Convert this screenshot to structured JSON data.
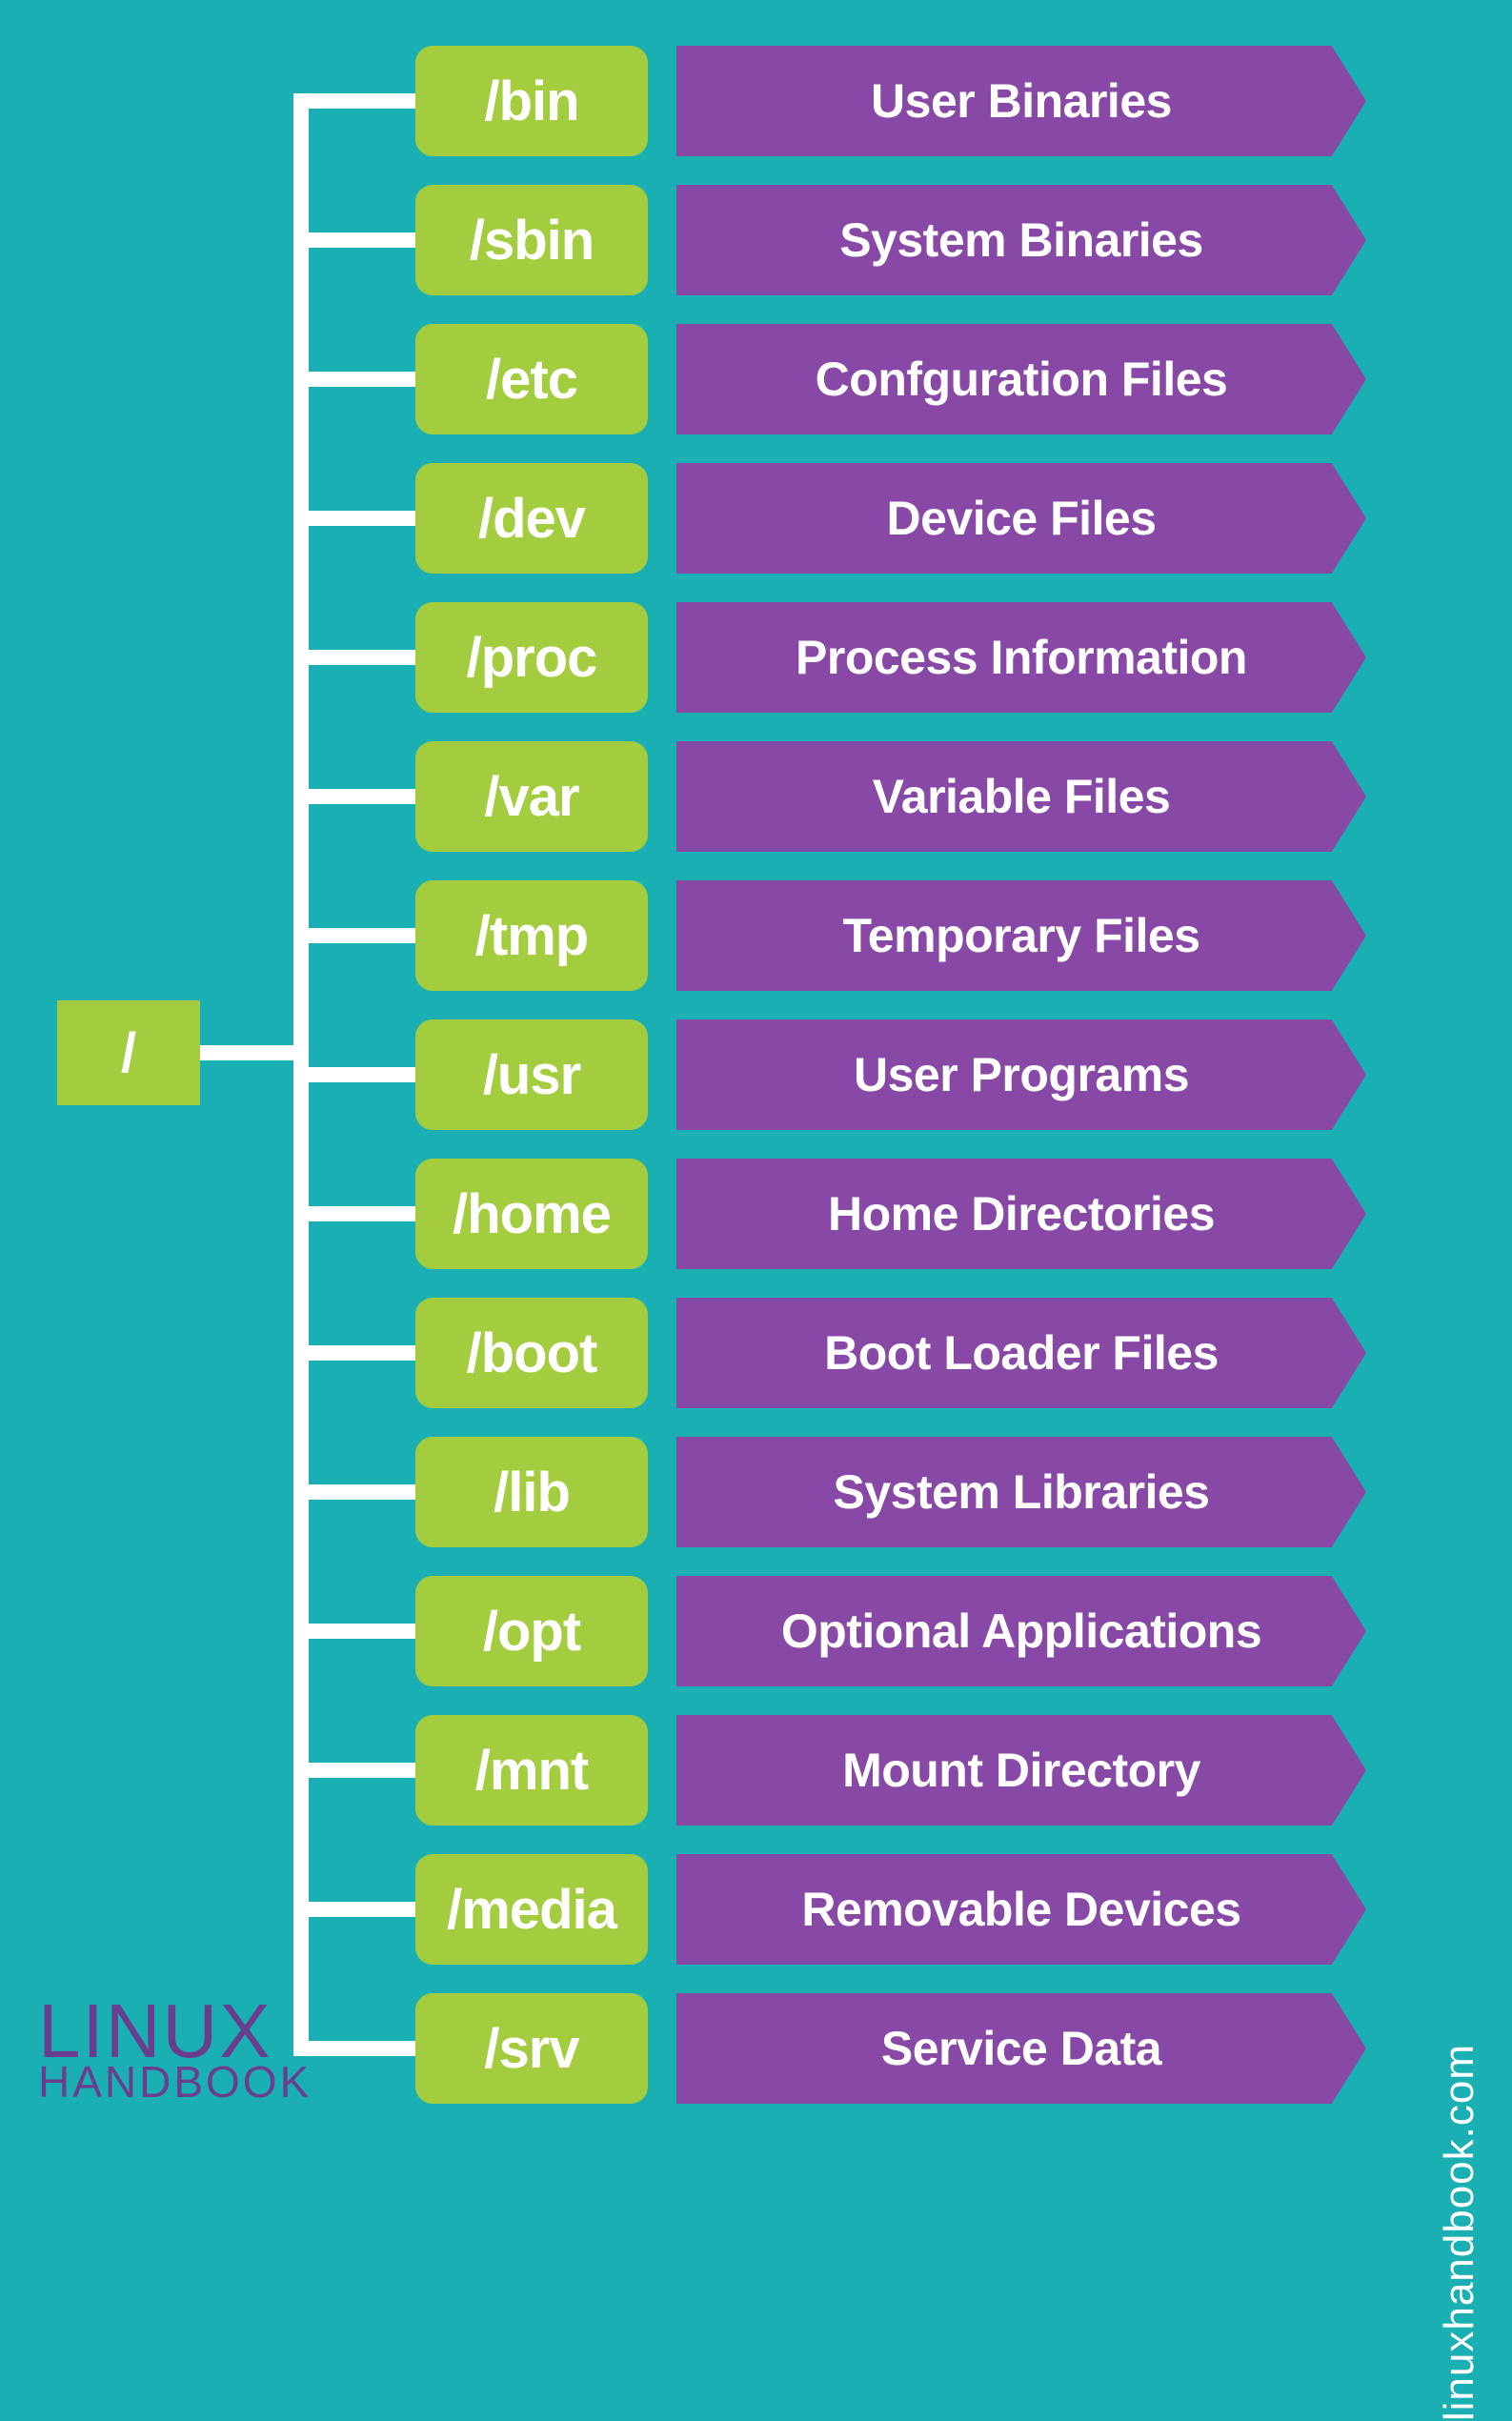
{
  "root": "/",
  "items": [
    {
      "dir": "/bin",
      "desc": "User Binaries"
    },
    {
      "dir": "/sbin",
      "desc": "System Binaries"
    },
    {
      "dir": "/etc",
      "desc": "Confguration Files"
    },
    {
      "dir": "/dev",
      "desc": "Device Files"
    },
    {
      "dir": "/proc",
      "desc": "Process Information"
    },
    {
      "dir": "/var",
      "desc": "Variable Files"
    },
    {
      "dir": "/tmp",
      "desc": "Temporary Files"
    },
    {
      "dir": "/usr",
      "desc": "User Programs"
    },
    {
      "dir": "/home",
      "desc": "Home Directories"
    },
    {
      "dir": "/boot",
      "desc": "Boot Loader Files"
    },
    {
      "dir": "/lib",
      "desc": "System Libraries"
    },
    {
      "dir": "/opt",
      "desc": "Optional Applications"
    },
    {
      "dir": "/mnt",
      "desc": "Mount Directory"
    },
    {
      "dir": "/media",
      "desc": "Removable Devices"
    },
    {
      "dir": "/srv",
      "desc": "Service Data"
    }
  ],
  "logo": {
    "top": "LINUX",
    "bottom": "HANDBOOK"
  },
  "watermark": "linuxhandbook.com"
}
